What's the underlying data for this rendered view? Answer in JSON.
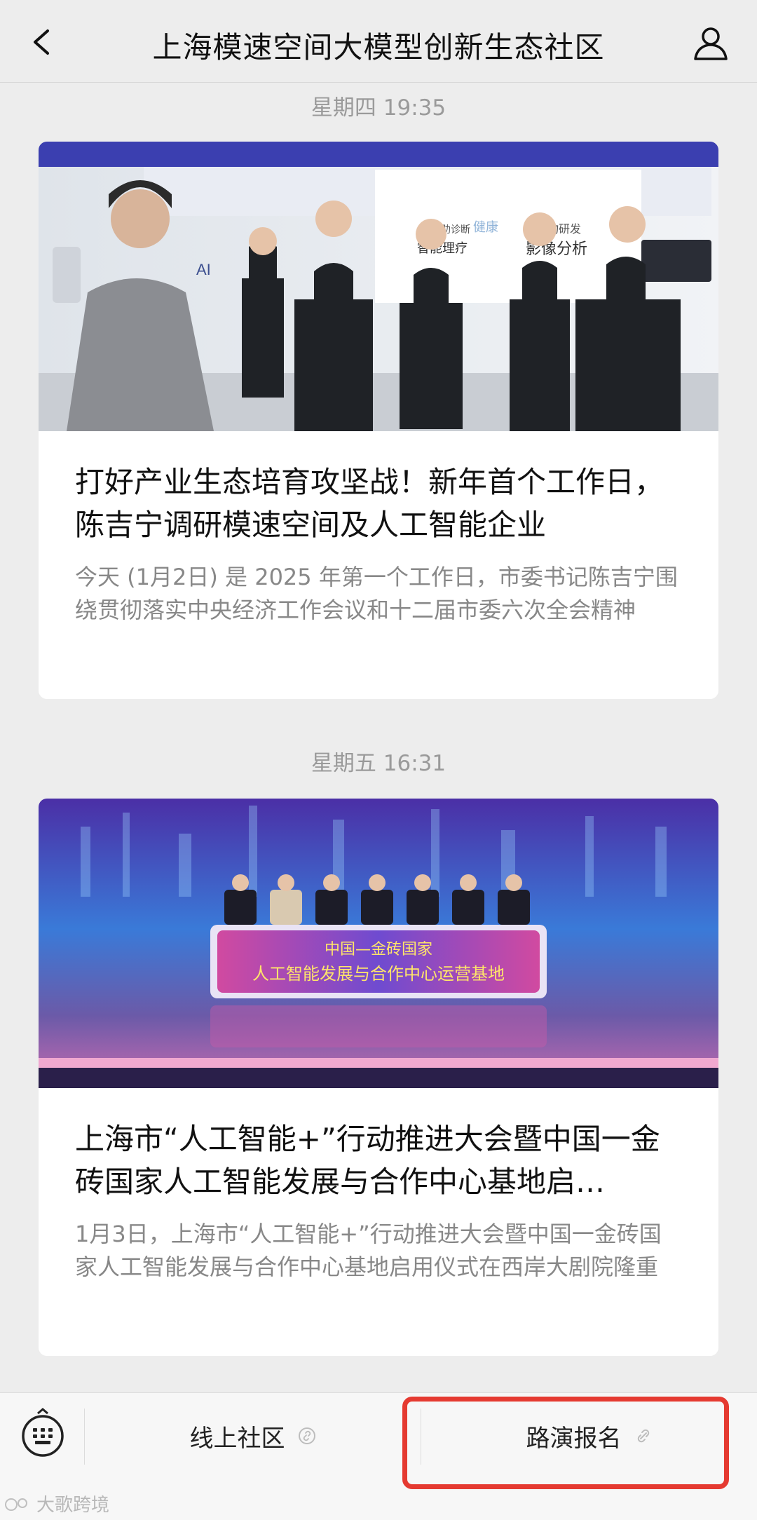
{
  "header": {
    "title": "上海模速空间大模型创新生态社区",
    "back_icon": "back-chevron-icon",
    "profile_icon": "person-icon"
  },
  "feed": [
    {
      "timestamp": "星期四 19:35",
      "title": "打好产业生态培育攻坚战！新年首个工作日，陈吉宁调研模速空间及人工智能企业",
      "description": "今天 (1月2日) 是 2025 年第一个工作日，市委书记陈吉宁围绕贯彻落实中央经济工作会议和十二届市委六次全会精神",
      "image_text": {
        "ai": "AI",
        "tag1": "辅助诊断",
        "tag2": "健康",
        "tag3": "药物研发",
        "tag4": "智能理疗",
        "tag5": "影像分析"
      }
    },
    {
      "timestamp": "星期五 16:31",
      "title": "上海市“人工智能+”行动推进大会暨中国一金砖国家人工智能发展与合作中心基地启…",
      "description": "1月3日，上海市“人工智能+”行动推进大会暨中国一金砖国家人工智能发展与合作中心基地启用仪式在西岸大剧院隆重",
      "image_text": {
        "line1": "中国—金砖国家",
        "line2": "人工智能发展与合作中心运营基地"
      }
    }
  ],
  "bottom_menu": {
    "keyboard_icon": "keyboard-icon",
    "items": [
      {
        "label": "线上社区",
        "icon": "link-icon"
      },
      {
        "label": "路演报名",
        "icon": "link-icon"
      }
    ],
    "highlight_color": "#e53a31"
  },
  "watermark": "大歌跨境"
}
